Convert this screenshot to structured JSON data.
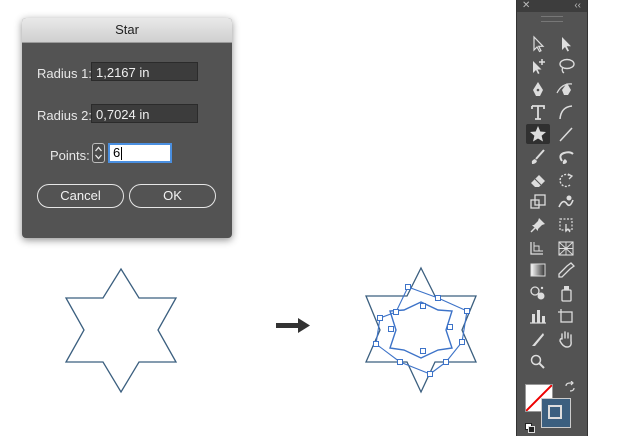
{
  "dialog": {
    "title": "Star",
    "radius1_label": "Radius 1:",
    "radius1_value": "1,2167 in",
    "radius2_label": "Radius 2:",
    "radius2_value": "0,7024 in",
    "points_label": "Points:",
    "points_value": "6",
    "cancel_label": "Cancel",
    "ok_label": "OK"
  },
  "toolbar": {
    "close_glyph": "✕",
    "collapse_glyph": "‹‹",
    "tools": [
      "selection-tool",
      "direct-selection-tool",
      "group-selection-tool",
      "lasso-tool",
      "pen-tool",
      "curvature-tool",
      "type-tool",
      "arc-tool",
      "star-tool",
      "line-tool",
      "paintbrush-tool",
      "blob-brush-tool",
      "eraser-tool",
      "rotate-tool",
      "scale-tool",
      "warp-tool",
      "pin-tool",
      "free-transform-tool",
      "shape-builder-tool",
      "perspective-grid-tool",
      "gradient-tool",
      "eyedropper-tool",
      "symbol-sprayer-tool",
      "graph-tool",
      "column-graph-tool",
      "artboard-tool",
      "slice-tool",
      "hand-tool",
      "zoom-tool"
    ],
    "active_tool": "star-tool"
  },
  "colors": {
    "dialog_bg": "#535353",
    "toolbar_bg": "#535353",
    "star_stroke": "#3b5f7f",
    "selection_blue": "#3d73c8",
    "input_focus": "#4a8fe0"
  }
}
